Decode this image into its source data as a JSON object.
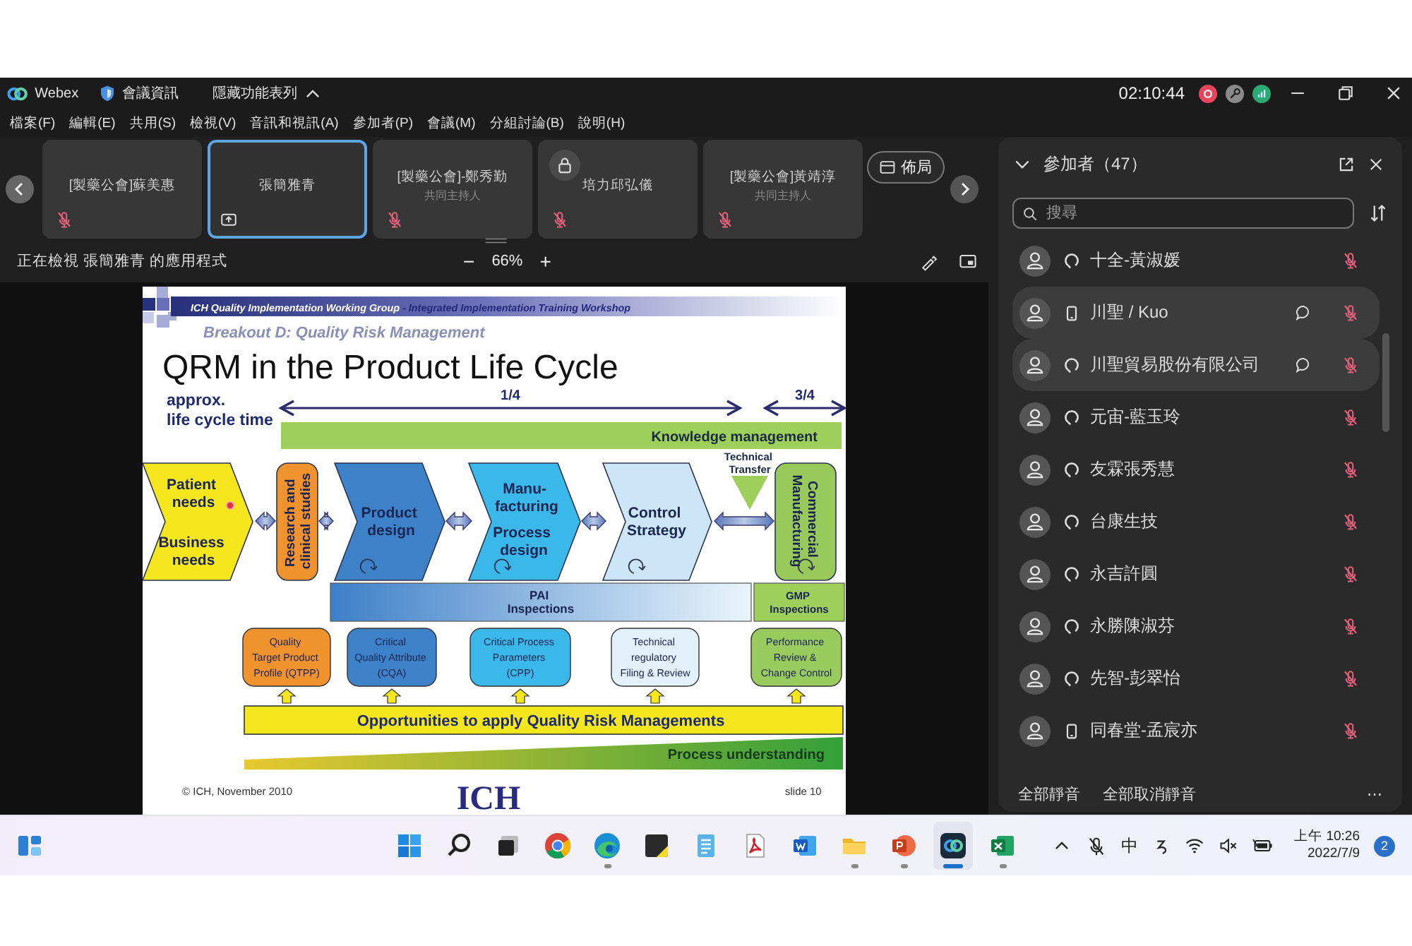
{
  "title_bar": {
    "app_name": "Webex",
    "meeting_info": "會議資訊",
    "hide_menu": "隱藏功能表列",
    "timer": "02:10:44"
  },
  "menu": [
    "檔案(F)",
    "編輯(E)",
    "共用(S)",
    "檢視(V)",
    "音訊和視訊(A)",
    "參加者(P)",
    "會議(M)",
    "分組討論(B)",
    "說明(H)"
  ],
  "video_strip": {
    "tiles": [
      {
        "name": "[製藥公會]蘇美惠",
        "muted": true,
        "selected": false,
        "locked": false,
        "sharing": false
      },
      {
        "name": "張簡雅青",
        "muted": false,
        "selected": true,
        "locked": false,
        "sharing": true
      },
      {
        "name": "[製藥公會]-鄭秀勤",
        "role": "共同主持人",
        "muted": true,
        "selected": false,
        "locked": false,
        "sharing": false
      },
      {
        "name": "培力邱弘儀",
        "muted": true,
        "selected": false,
        "locked": true,
        "sharing": false
      },
      {
        "name": "[製藥公會]黃靖淳",
        "role": "共同主持人",
        "muted": true,
        "selected": false,
        "locked": false,
        "sharing": false
      }
    ],
    "layout_button": "佈局"
  },
  "viewer": {
    "caption": "正在檢視 張簡雅青 的應用程式",
    "zoom_out": "−",
    "zoom": "66%",
    "zoom_in": "+"
  },
  "slide": {
    "header": {
      "group": "ICH Quality Implementation Working Group",
      "workshop": "- Integrated Implementation Training Workshop"
    },
    "breakout": "Breakout D: Quality Risk Management",
    "title": "QRM in the Product Life Cycle",
    "time_label": [
      "approx.",
      "life cycle time"
    ],
    "spans": [
      {
        "label": "1/4"
      },
      {
        "label": "3/4"
      }
    ],
    "knowledge_bar": "Knowledge management",
    "transfer_label": [
      "Technical",
      "Transfer"
    ],
    "stages": [
      {
        "kind": "chevron",
        "color": "#f5e61e",
        "labels": [
          [
            "Patient",
            "needs"
          ],
          [
            "Business",
            "needs"
          ]
        ],
        "pointer": true,
        "loop": false
      },
      {
        "kind": "pill",
        "color": "#f0922e",
        "labels": [
          [
            "Research and",
            "clinical studies"
          ]
        ],
        "pointer": false,
        "loop": false
      },
      {
        "kind": "chevron",
        "color": "#3d82c9",
        "labels": [
          [
            "Product",
            "design"
          ]
        ],
        "pointer": false,
        "loop": true
      },
      {
        "kind": "chevron",
        "color": "#3ab8ea",
        "labels": [
          [
            "Manu-",
            "facturing"
          ],
          [
            "Process",
            "design"
          ]
        ],
        "pointer": false,
        "loop": true
      },
      {
        "kind": "chevron",
        "color": "#cde6f7",
        "labels": [
          [
            "Control",
            "Strategy"
          ]
        ],
        "pointer": false,
        "loop": true
      },
      {
        "kind": "pill",
        "color": "#98c95a",
        "labels": [
          [
            "Commercial",
            "Manufacturing"
          ]
        ],
        "pointer": false,
        "loop": true
      }
    ],
    "inspections": [
      {
        "lines": [
          "PAI",
          "Inspections"
        ]
      },
      {
        "lines": [
          "GMP",
          "Inspections"
        ]
      }
    ],
    "tools": [
      {
        "lines": [
          "Quality",
          "Target Product",
          "Profile (QTPP)"
        ],
        "color": "#f0922e"
      },
      {
        "lines": [
          "Critical",
          "Quality Attribute",
          "(CQA)"
        ],
        "color": "#3d82c9"
      },
      {
        "lines": [
          "Critical Process",
          "Parameters",
          "(CPP)"
        ],
        "color": "#3ab8ea"
      },
      {
        "lines": [
          "Technical",
          "regulatory",
          "Filing & Review"
        ],
        "color": "#e3f1fb"
      },
      {
        "lines": [
          "Performance",
          "Review &",
          "Change Control"
        ],
        "color": "#9acb5e"
      }
    ],
    "opportunities": "Opportunities to apply Quality Risk Managements",
    "process_understanding": "Process understanding",
    "footer": {
      "copyright": "© ICH, November 2010",
      "logo": "ICH",
      "slide_number": "slide 10"
    }
  },
  "participants": {
    "title": "參加者（47）",
    "search_placeholder": "搜尋",
    "rows": [
      {
        "name": "十全-黃淑媛",
        "kind": "audio",
        "chat": false,
        "highlighted": false,
        "muted": true
      },
      {
        "name": "川聖 / Kuo",
        "kind": "phone",
        "chat": true,
        "highlighted": true,
        "muted": true
      },
      {
        "name": "川聖貿易股份有限公司",
        "kind": "audio",
        "chat": true,
        "highlighted": true,
        "muted": true
      },
      {
        "name": "元宙-藍玉玲",
        "kind": "audio",
        "chat": false,
        "highlighted": false,
        "muted": true
      },
      {
        "name": "友霖張秀慧",
        "kind": "audio",
        "chat": false,
        "highlighted": false,
        "muted": true
      },
      {
        "name": "台康生技",
        "kind": "audio",
        "chat": false,
        "highlighted": false,
        "muted": true
      },
      {
        "name": "永吉許圓",
        "kind": "audio",
        "chat": false,
        "highlighted": false,
        "muted": true
      },
      {
        "name": "永勝陳淑芬",
        "kind": "audio",
        "chat": false,
        "highlighted": false,
        "muted": true
      },
      {
        "name": "先智-彭翠怡",
        "kind": "audio",
        "chat": false,
        "highlighted": false,
        "muted": true
      },
      {
        "name": "同春堂-孟宸亦",
        "kind": "phone",
        "chat": false,
        "highlighted": false,
        "muted": true
      }
    ],
    "mute_all": "全部靜音",
    "unmute_all": "全部取消靜音",
    "more": "⋯"
  },
  "taskbar": {
    "apps": [
      {
        "running": false,
        "active": false
      },
      {
        "running": false,
        "active": false
      },
      {
        "running": false,
        "active": false
      },
      {
        "running": false,
        "active": false
      },
      {
        "running": true,
        "active": false
      },
      {
        "running": false,
        "active": false
      },
      {
        "running": false,
        "active": false
      },
      {
        "running": false,
        "active": false
      },
      {
        "running": false,
        "active": false
      },
      {
        "running": true,
        "active": false
      },
      {
        "running": true,
        "active": false
      },
      {
        "running": true,
        "active": true
      },
      {
        "running": true,
        "active": false
      }
    ],
    "ime": "中",
    "time": "上午 10:26",
    "date": "2022/7/9",
    "notifications": "2"
  }
}
